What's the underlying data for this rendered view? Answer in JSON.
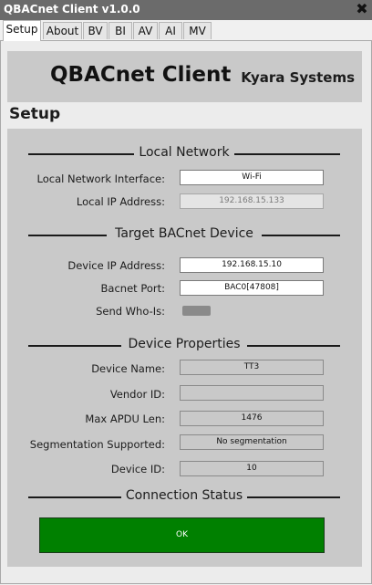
{
  "window": {
    "title": "QBACnet Client v1.0.0"
  },
  "tabs": [
    "Setup",
    "About",
    "BV",
    "BI",
    "AV",
    "AI",
    "MV"
  ],
  "header": {
    "app_name": "QBACnet Client",
    "company": "Kyara Systems"
  },
  "page_title": "Setup",
  "local_network": {
    "heading": "Local Network",
    "interface_label": "Local Network Interface:",
    "interface_value": "Wi-Fi",
    "ip_label": "Local IP Address:",
    "ip_value": "192.168.15.133"
  },
  "target_device": {
    "heading": "Target BACnet Device",
    "ip_label": "Device IP Address:",
    "ip_value": "192.168.15.10",
    "port_label": "Bacnet Port:",
    "port_value": "BAC0[47808]",
    "whois_label": "Send Who-Is:"
  },
  "device_properties": {
    "heading": "Device Properties",
    "name_label": "Device Name:",
    "name_value": "TT3",
    "vendor_label": "Vendor ID:",
    "vendor_value": "",
    "apdu_label": "Max APDU Len:",
    "apdu_value": "1476",
    "seg_label": "Segmentation Supported:",
    "seg_value": "No segmentation",
    "id_label": "Device ID:",
    "id_value": "10"
  },
  "connection": {
    "heading": "Connection Status",
    "status": "OK",
    "status_color": "#008000"
  },
  "icons": {
    "close": "close-icon"
  }
}
